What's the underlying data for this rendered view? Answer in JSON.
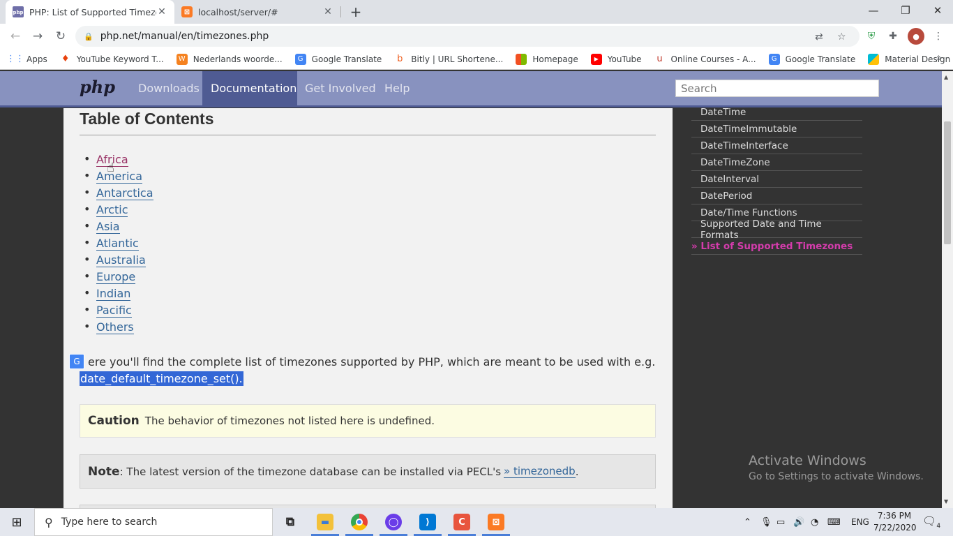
{
  "browser": {
    "tabs": [
      {
        "title": "PHP: List of Supported Timezones",
        "favicon": "php-icon",
        "active": true
      },
      {
        "title": "localhost/server/#",
        "favicon": "xampp-icon",
        "active": false
      }
    ],
    "url": "php.net/manual/en/timezones.php",
    "new_tab": "+",
    "window_controls": {
      "minimize": "—",
      "restore": "❐",
      "close": "✕"
    },
    "bookmarks": [
      {
        "label": "Apps",
        "icon": "apps-grid-icon",
        "color": "#4285f4"
      },
      {
        "label": "YouTube Keyword T...",
        "icon": "flame-icon",
        "color": "#e8410c"
      },
      {
        "label": "Nederlands woorde...",
        "icon": "w-logo-icon",
        "color": "#f58220"
      },
      {
        "label": "Google Translate",
        "icon": "translate-icon",
        "color": "#4285f4"
      },
      {
        "label": "Bitly | URL Shortene...",
        "icon": "bitly-icon",
        "color": "#ee6123"
      },
      {
        "label": "Homepage",
        "icon": "windows-logo-icon",
        "color": "#f25022"
      },
      {
        "label": "YouTube",
        "icon": "youtube-icon",
        "color": "#ff0000"
      },
      {
        "label": "Online Courses - A...",
        "icon": "udemy-icon",
        "color": "#a435f0"
      },
      {
        "label": "Google Translate",
        "icon": "translate-icon",
        "color": "#4285f4"
      },
      {
        "label": "Material Design Col...",
        "icon": "material-icon",
        "color": "#00bcd4"
      }
    ]
  },
  "php_nav": {
    "logo": "php",
    "links": [
      "Downloads",
      "Documentation",
      "Get Involved",
      "Help"
    ],
    "active": "Documentation",
    "search_placeholder": "Search"
  },
  "main": {
    "toc_title": "Table of Contents",
    "toc_items": [
      "Africa",
      "America",
      "Antarctica",
      "Arctic",
      "Asia",
      "Atlantic",
      "Australia",
      "Europe",
      "Indian",
      "Pacific",
      "Others"
    ],
    "intro_text": "ere you'll find the complete list of timezones supported by PHP, which are meant to be used with e.g.",
    "intro_function": "date_default_timezone_set().",
    "caution_label": "Caution",
    "caution_text": "The behavior of timezones not listed here is undefined.",
    "note_label": "Note",
    "note_text": ": The latest version of the timezone database can be installed via PECL's",
    "note_link": "» timezonedb",
    "note_end": "."
  },
  "sidebar": {
    "items": [
      "DateTime",
      "DateTimeImmutable",
      "DateTimeInterface",
      "DateTimeZone",
      "DateInterval",
      "DatePeriod",
      "Date/Time Functions",
      "Supported Date and Time Formats"
    ],
    "current": "» List of Supported Timezones"
  },
  "watermark": {
    "title": "Activate Windows",
    "subtitle": "Go to Settings to activate Windows."
  },
  "taskbar": {
    "search_placeholder": "Type here to search",
    "language": "ENG",
    "time": "7:36 PM",
    "date": "7/22/2020",
    "notification_count": "4"
  },
  "colors": {
    "php_nav": "#8892bf",
    "php_nav_active": "#4f5b93",
    "link": "#336699",
    "visited_link": "#993366",
    "sidebar_current": "#d33cab",
    "selection": "#3367d6"
  }
}
